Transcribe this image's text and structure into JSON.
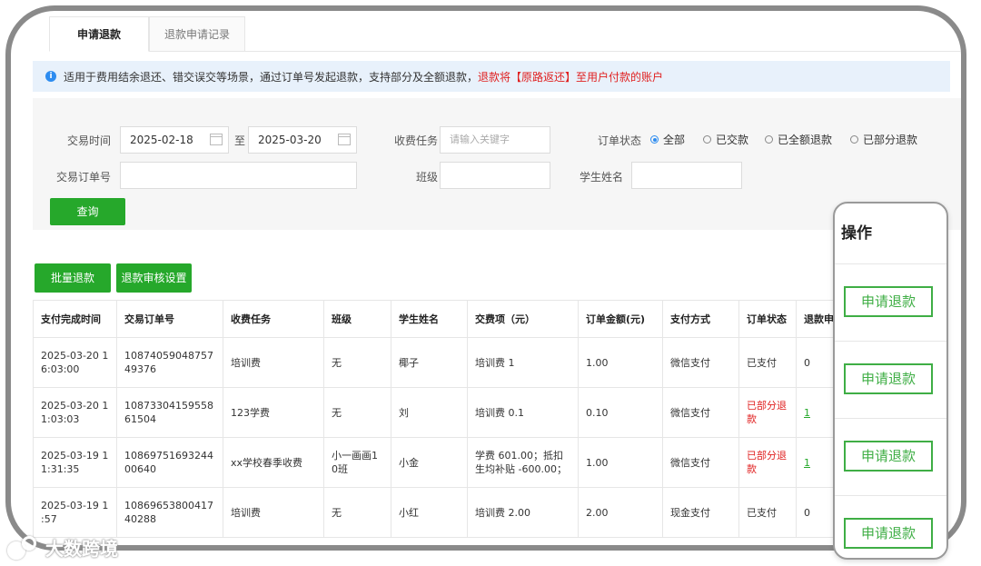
{
  "tabs": [
    {
      "label": "申请退款",
      "active": true
    },
    {
      "label": "退款申请记录",
      "active": false
    }
  ],
  "notice": {
    "text": "适用于费用结余退还、错交误交等场景，通过订单号发起退款，支持部分及全额退款，",
    "highlight": "退款将【原路返还】至用户付款的账户"
  },
  "filters": {
    "trade_time_label": "交易时间",
    "date_from": "2025-02-18",
    "to_label": "至",
    "date_to": "2025-03-20",
    "task_label": "收费任务",
    "task_placeholder": "请输入关键字",
    "status_label": "订单状态",
    "status_options": [
      "全部",
      "已交款",
      "已全额退款",
      "已部分退款"
    ],
    "status_selected": "全部",
    "order_no_label": "交易订单号",
    "order_no_value": "",
    "class_label": "班级",
    "class_value": "",
    "student_label": "学生姓名",
    "student_value": "",
    "query_label": "查询"
  },
  "actions": {
    "batch_refund": "批量退款",
    "refund_review_settings": "退款审核设置"
  },
  "table": {
    "columns": [
      "支付完成时间",
      "交易订单号",
      "收费任务",
      "班级",
      "学生姓名",
      "交费项（元）",
      "订单金额(元)",
      "支付方式",
      "订单状态",
      "退款申"
    ],
    "rows": [
      [
        "2025-03-20 16:03:00",
        "1087405904875749376",
        "培训费",
        "无",
        "椰子",
        "培训费 1",
        "1.00",
        "微信支付",
        "已支付",
        "0"
      ],
      [
        "2025-03-20 11:03:03",
        "1087330415955861504",
        "123学费",
        "无",
        "刘",
        "培训费 0.1",
        "0.10",
        "微信支付",
        "已部分退款",
        "1"
      ],
      [
        "2025-03-19 11:31:35",
        "1086975169324400640",
        "xx学校春季收费",
        "小一画画10班",
        "小金",
        "学费 601.00；抵扣生均补贴 -600.00；",
        "1.00",
        "微信支付",
        "已部分退款",
        "1"
      ],
      [
        "2025-03-19 1 :57",
        "1086965380041740288",
        "培训费",
        "无",
        "小红",
        "培训费 2.00",
        "2.00",
        "现金支付",
        "已支付",
        "0"
      ]
    ]
  },
  "ops_panel": {
    "header": "操作",
    "buttons": [
      "申请退款",
      "申请退款",
      "申请退款",
      "申请退款"
    ]
  },
  "watermark": "大数跨境",
  "colors": {
    "primary_green": "#26a82b",
    "info_blue": "#2d8cf0",
    "alert_red": "#e02020",
    "notice_bg": "#e8f1fb"
  }
}
